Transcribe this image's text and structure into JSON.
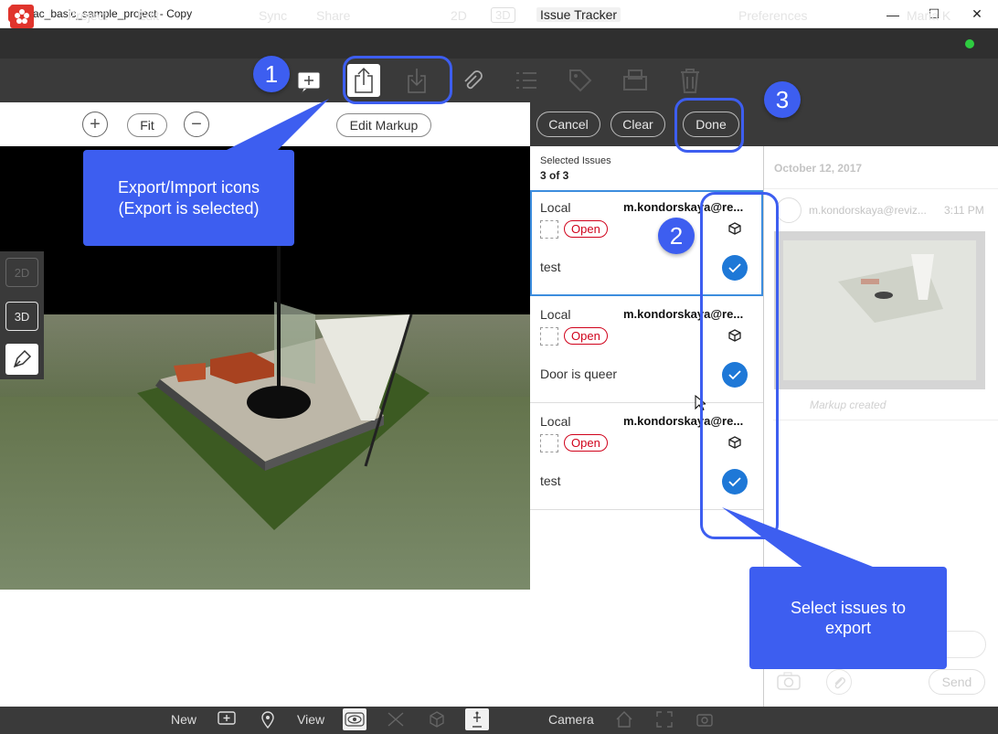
{
  "window": {
    "title": "rac_basic_sample_project - Copy",
    "minimize": "—",
    "maximize": "☐",
    "close": "✕"
  },
  "menubar": {
    "project": "Project",
    "edit": "Edit",
    "sync": "Sync",
    "share": "Share",
    "view2d": "2D",
    "view3d": "3D",
    "issue_tracker": "Issue Tracker",
    "preferences": "Preferences",
    "user": "Maria K",
    "online_color": "#2ecc40"
  },
  "viewport_toolbar": {
    "zoom_in": "+",
    "fit": "Fit",
    "zoom_out": "−",
    "edit_markup": "Edit Markup"
  },
  "side_tools": {
    "btn_2d": "2D",
    "btn_3d": "3D"
  },
  "issue_header": {
    "cancel": "Cancel",
    "clear": "Clear",
    "done": "Done"
  },
  "issues": {
    "selected_label": "Selected Issues",
    "selected_count": "3 of 3",
    "items": [
      {
        "source": "Local",
        "author": "m.kondorskaya@re...",
        "status": "Open",
        "description": "test"
      },
      {
        "source": "Local",
        "author": "m.kondorskaya@re...",
        "status": "Open",
        "description": "Door is queer"
      },
      {
        "source": "Local",
        "author": "m.kondorskaya@re...",
        "status": "Open",
        "description": "test"
      }
    ]
  },
  "detail": {
    "date": "October 12, 2017",
    "user": "m.kondorskaya@reviz...",
    "time": "3:11 PM",
    "caption": "Markup created",
    "send": "Send"
  },
  "bottombar": {
    "new": "New",
    "view": "View",
    "camera": "Camera"
  },
  "callouts": {
    "badge1": "1",
    "badge2": "2",
    "badge3": "3",
    "export_import_line1": "Export/Import icons",
    "export_import_line2": "(Export is selected)",
    "select_line1": "Select issues to",
    "select_line2": "export"
  },
  "colors": {
    "accent": "#3d5ef0",
    "status_open": "#d0021b",
    "check": "#1e78d7",
    "brand": "#e0342c"
  }
}
